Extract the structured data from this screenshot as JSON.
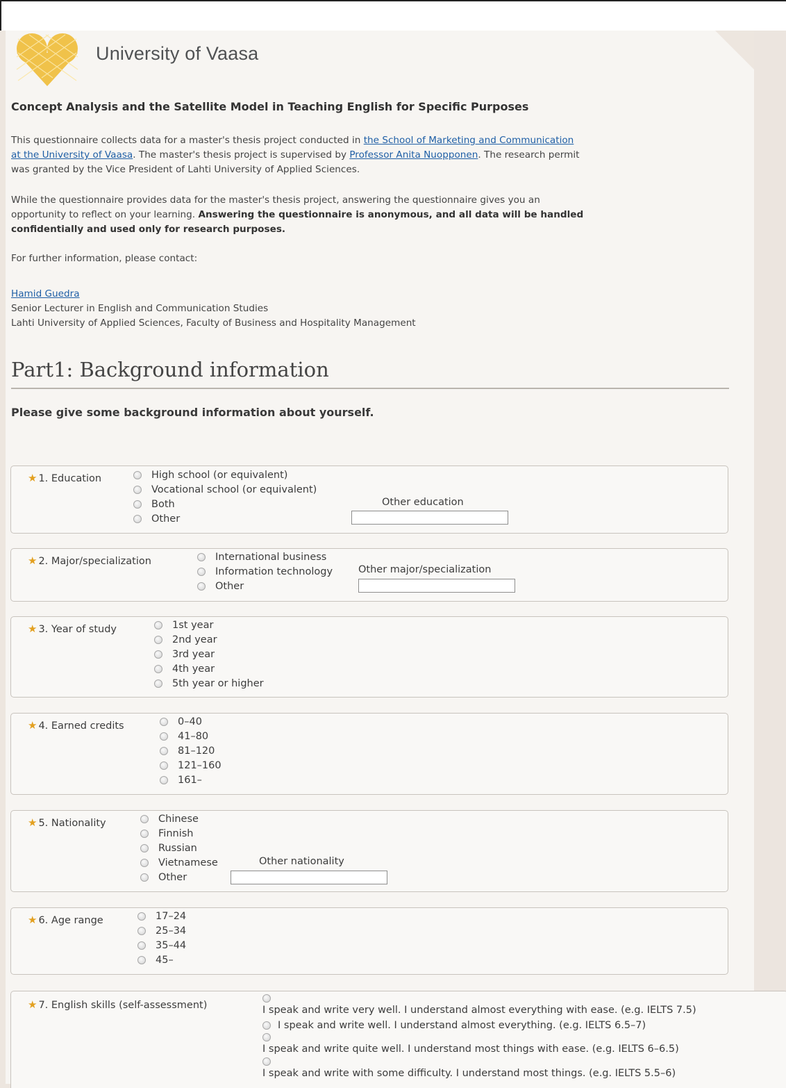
{
  "header": {
    "university_name": "University of Vaasa"
  },
  "survey": {
    "title": "Concept Analysis and the Satellite Model in Teaching English for Specific Purposes",
    "intro": {
      "p1_line1_text": "This questionnaire collects data for a master's thesis project conducted in ",
      "p1_line1_link": "the School of Marketing and Communication",
      "p1_line2_link": "at the University of Vaasa",
      "p1_line2_text": ". The master's thesis project is supervised by ",
      "p1_line2_link2": "Professor Anita Nuopponen",
      "p1_line2_text2": ". The research permit",
      "p1_line3": "was granted by the Vice President of Lahti University of Applied Sciences.",
      "p2_line1": "While the questionnaire provides data for the master's thesis project, answering the questionnaire gives you an",
      "p2_line2_text": "opportunity to reflect on your learning. ",
      "p2_line2_bold": "Answering the questionnaire is anonymous, and all data will be handled",
      "p2_line3_bold": "confidentially and used only for research purposes.",
      "p3": "For further information, please contact:",
      "contact_name": "Hamid Guedra",
      "contact_title": "Senior Lecturer in English and Communication Studies",
      "contact_org": "Lahti University of Applied Sciences, Faculty of Business and Hospitality Management"
    }
  },
  "part1": {
    "title": "Part1: Background information",
    "subtitle": "Please give some background information about yourself."
  },
  "questions": [
    {
      "label": "1. Education",
      "options": [
        "High school (or equivalent)",
        "Vocational school (or equivalent)",
        "Both",
        "Other"
      ],
      "other_label": "Other education"
    },
    {
      "label": "2. Major/specialization",
      "options": [
        "International business",
        "Information technology",
        "Other"
      ],
      "other_label": "Other major/specialization"
    },
    {
      "label": "3. Year of study",
      "options": [
        "1st year",
        "2nd year",
        "3rd year",
        "4th year",
        "5th year or higher"
      ]
    },
    {
      "label": "4. Earned credits",
      "options": [
        "0–40",
        "41–80",
        "81–120",
        "121–160",
        "161–"
      ]
    },
    {
      "label": "5. Nationality",
      "options": [
        "Chinese",
        "Finnish",
        "Russian",
        "Vietnamese",
        "Other"
      ],
      "other_label": "Other nationality"
    },
    {
      "label": "6. Age range",
      "options": [
        "17–24",
        "25–34",
        "35–44",
        "45–"
      ]
    },
    {
      "label": "7. English skills (self-assessment)",
      "options": [
        "I speak and write very well. I understand almost everything with ease. (e.g. IELTS 7.5)",
        "I speak and write well. I understand almost everything. (e.g. IELTS 6.5–7)",
        "I speak and write quite well. I understand most things with ease. (e.g. IELTS 6–6.5)",
        "I speak and write with some difficulty. I understand most things. (e.g. IELTS 5.5–6)"
      ]
    }
  ],
  "colors": {
    "link": "#1f5fa6",
    "required_star": "#e3a020",
    "page_background": "#f7f5f2",
    "logo_gold": "#f0c24a"
  }
}
